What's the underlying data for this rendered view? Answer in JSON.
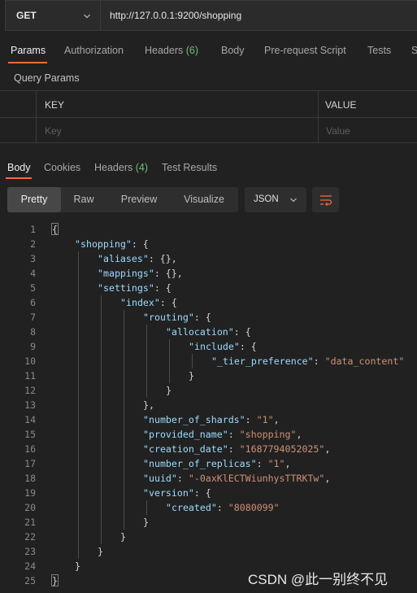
{
  "request": {
    "method": "GET",
    "url": "http://127.0.0.1:9200/shopping"
  },
  "request_tabs": [
    {
      "label": "Params",
      "count": ""
    },
    {
      "label": "Authorization",
      "count": ""
    },
    {
      "label": "Headers",
      "count": "(6)"
    },
    {
      "label": "Body",
      "count": ""
    },
    {
      "label": "Pre-request Script",
      "count": ""
    },
    {
      "label": "Tests",
      "count": ""
    },
    {
      "label": "S",
      "count": ""
    }
  ],
  "query_params": {
    "title": "Query Params",
    "col_key": "KEY",
    "col_value": "VALUE",
    "key_placeholder": "Key",
    "value_placeholder": "Value"
  },
  "response_tabs": [
    {
      "label": "Body",
      "count": ""
    },
    {
      "label": "Cookies",
      "count": ""
    },
    {
      "label": "Headers",
      "count": "(4)"
    },
    {
      "label": "Test Results",
      "count": ""
    }
  ],
  "view_modes": [
    "Pretty",
    "Raw",
    "Preview",
    "Visualize"
  ],
  "format": "JSON",
  "code_lines": [
    {
      "n": "1",
      "indent": 0,
      "parts": [
        [
          "p",
          "{"
        ]
      ]
    },
    {
      "n": "2",
      "indent": 1,
      "parts": [
        [
          "k",
          "\"shopping\""
        ],
        [
          "p",
          ": {"
        ]
      ]
    },
    {
      "n": "3",
      "indent": 2,
      "parts": [
        [
          "k",
          "\"aliases\""
        ],
        [
          "p",
          ": {},"
        ]
      ]
    },
    {
      "n": "4",
      "indent": 2,
      "parts": [
        [
          "k",
          "\"mappings\""
        ],
        [
          "p",
          ": {},"
        ]
      ]
    },
    {
      "n": "5",
      "indent": 2,
      "parts": [
        [
          "k",
          "\"settings\""
        ],
        [
          "p",
          ": {"
        ]
      ]
    },
    {
      "n": "6",
      "indent": 3,
      "parts": [
        [
          "k",
          "\"index\""
        ],
        [
          "p",
          ": {"
        ]
      ]
    },
    {
      "n": "7",
      "indent": 4,
      "parts": [
        [
          "k",
          "\"routing\""
        ],
        [
          "p",
          ": {"
        ]
      ]
    },
    {
      "n": "8",
      "indent": 5,
      "parts": [
        [
          "k",
          "\"allocation\""
        ],
        [
          "p",
          ": {"
        ]
      ]
    },
    {
      "n": "9",
      "indent": 6,
      "parts": [
        [
          "k",
          "\"include\""
        ],
        [
          "p",
          ": {"
        ]
      ]
    },
    {
      "n": "10",
      "indent": 7,
      "parts": [
        [
          "k",
          "\"_tier_preference\""
        ],
        [
          "p",
          ": "
        ],
        [
          "s",
          "\"data_content\""
        ]
      ]
    },
    {
      "n": "11",
      "indent": 6,
      "parts": [
        [
          "p",
          "}"
        ]
      ]
    },
    {
      "n": "12",
      "indent": 5,
      "parts": [
        [
          "p",
          "}"
        ]
      ]
    },
    {
      "n": "13",
      "indent": 4,
      "parts": [
        [
          "p",
          "},"
        ]
      ]
    },
    {
      "n": "14",
      "indent": 4,
      "parts": [
        [
          "k",
          "\"number_of_shards\""
        ],
        [
          "p",
          ": "
        ],
        [
          "s",
          "\"1\""
        ],
        [
          "p",
          ","
        ]
      ]
    },
    {
      "n": "15",
      "indent": 4,
      "parts": [
        [
          "k",
          "\"provided_name\""
        ],
        [
          "p",
          ": "
        ],
        [
          "s",
          "\"shopping\""
        ],
        [
          "p",
          ","
        ]
      ]
    },
    {
      "n": "16",
      "indent": 4,
      "parts": [
        [
          "k",
          "\"creation_date\""
        ],
        [
          "p",
          ": "
        ],
        [
          "s",
          "\"1687794052025\""
        ],
        [
          "p",
          ","
        ]
      ]
    },
    {
      "n": "17",
      "indent": 4,
      "parts": [
        [
          "k",
          "\"number_of_replicas\""
        ],
        [
          "p",
          ": "
        ],
        [
          "s",
          "\"1\""
        ],
        [
          "p",
          ","
        ]
      ]
    },
    {
      "n": "18",
      "indent": 4,
      "parts": [
        [
          "k",
          "\"uuid\""
        ],
        [
          "p",
          ": "
        ],
        [
          "s",
          "\"-0axKlECTWiunhysTTRKTw\""
        ],
        [
          "p",
          ","
        ]
      ]
    },
    {
      "n": "19",
      "indent": 4,
      "parts": [
        [
          "k",
          "\"version\""
        ],
        [
          "p",
          ": {"
        ]
      ]
    },
    {
      "n": "20",
      "indent": 5,
      "parts": [
        [
          "k",
          "\"created\""
        ],
        [
          "p",
          ": "
        ],
        [
          "s",
          "\"8080099\""
        ]
      ]
    },
    {
      "n": "21",
      "indent": 4,
      "parts": [
        [
          "p",
          "}"
        ]
      ]
    },
    {
      "n": "22",
      "indent": 3,
      "parts": [
        [
          "p",
          "}"
        ]
      ]
    },
    {
      "n": "23",
      "indent": 2,
      "parts": [
        [
          "p",
          "}"
        ]
      ]
    },
    {
      "n": "24",
      "indent": 1,
      "parts": [
        [
          "p",
          "}"
        ]
      ]
    },
    {
      "n": "25",
      "indent": 0,
      "parts": [
        [
          "p",
          "}"
        ]
      ]
    }
  ],
  "watermark": "CSDN @此一别终不见"
}
